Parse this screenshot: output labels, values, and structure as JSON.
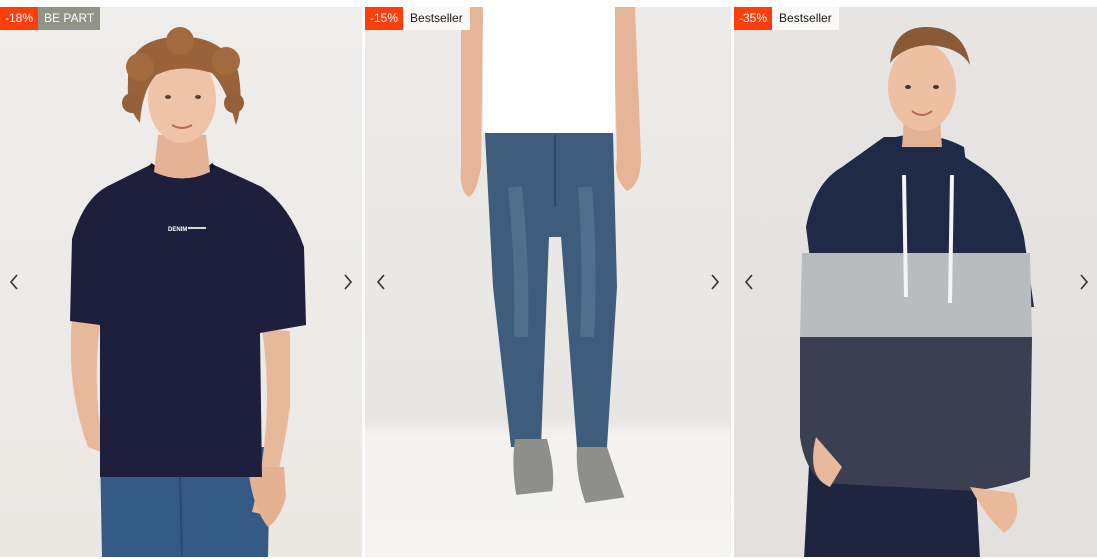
{
  "products": [
    {
      "badges": {
        "discount": "-18%",
        "tag": "BE PART"
      },
      "print_text": "DENIM",
      "colors": {
        "shirt": "#1d1f3d",
        "jeans": "#365a86"
      }
    },
    {
      "badges": {
        "discount": "-15%",
        "tag": "Bestseller"
      },
      "colors": {
        "jeans": "#3e5d7c",
        "shirt": "#ffffff",
        "shoes": "#8e8e8b"
      }
    },
    {
      "badges": {
        "discount": "-35%",
        "tag": "Bestseller"
      },
      "colors": {
        "navy": "#1f2a48",
        "grey": "#b9bcbf",
        "charcoal": "#3b3f52"
      }
    }
  ],
  "icons": {
    "prev": "chevron-left-icon",
    "next": "chevron-right-icon"
  },
  "accent_colors": {
    "discount_badge": "#fc3e0b",
    "be_part_badge": "#8f9487",
    "bestseller_badge": "#faf9f7"
  }
}
